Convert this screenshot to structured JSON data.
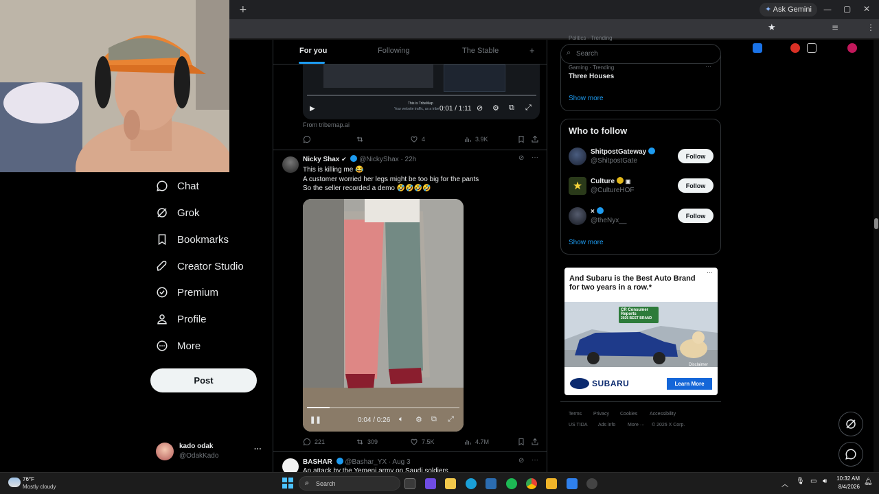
{
  "browser": {
    "ask_gemini": "Ask Gemini",
    "new_tab": "+",
    "minimize": "—",
    "maximize": "▢",
    "close": "✕"
  },
  "nav": {
    "items": [
      {
        "label": "Chat",
        "icon": "chat-icon"
      },
      {
        "label": "Grok",
        "icon": "grok-icon"
      },
      {
        "label": "Bookmarks",
        "icon": "bookmark-icon"
      },
      {
        "label": "Creator Studio",
        "icon": "rocket-icon"
      },
      {
        "label": "Premium",
        "icon": "premium-icon"
      },
      {
        "label": "Profile",
        "icon": "profile-icon"
      },
      {
        "label": "More",
        "icon": "more-icon"
      }
    ],
    "post_label": "Post",
    "account": {
      "name": "kado odak",
      "handle": "@OdakKado",
      "menu": "···"
    }
  },
  "feed": {
    "tabs": [
      "For you",
      "Following",
      "The Stable"
    ],
    "add_tab": "+",
    "tweet0": {
      "video_time": "0:01 / 1:11",
      "video_caption": "This is TribeMap",
      "video_caption_sub": "Your website traffic, as a tribe",
      "from": "From tribemap.ai",
      "likes": "4",
      "views": "3.9K"
    },
    "tweet1": {
      "name": "Nicky Shax",
      "handle": "@NickyShax",
      "time": "· 22h",
      "lines": [
        "This is killing me 😂",
        "A customer worried her legs might be too big for the pants",
        "So the seller recorded a demo 🤣🤣🤣🤣"
      ],
      "video_time": "0:04 / 0:26",
      "video_progress": 0.15,
      "replies": "221",
      "reposts": "309",
      "likes": "7.5K",
      "views": "4.7M",
      "menu": "···"
    },
    "tweet2": {
      "name": "BASHAR",
      "handle": "@Bashar_YX",
      "time": "· Aug 3",
      "line": "An attack by the Yemeni army on Saudi soldiers"
    }
  },
  "sidebar": {
    "search_placeholder": "Search",
    "partial_top": "Politics · Trending",
    "trend": {
      "category": "Gaming · Trending",
      "title": "Three Houses",
      "menu": "···"
    },
    "show_more": "Show more",
    "who_to_follow": {
      "title": "Who to follow",
      "users": [
        {
          "name": "ShitpostGateway",
          "handle": "@ShitpostGate",
          "button": "Follow"
        },
        {
          "name": "Culture",
          "handle": "@CultureHOF",
          "button": "Follow"
        },
        {
          "name": "×",
          "handle": "@theNyx__",
          "button": "Follow"
        }
      ],
      "show_more": "Show more"
    },
    "ad": {
      "headline": "And Subaru is the Best Auto Brand for two years in a row.*",
      "badge_top": "CR Consumer Reports",
      "badge_bottom": "2026 BEST BRAND",
      "disclaimer": "Disclaimer",
      "brand": "SUBARU",
      "cta": "Learn More",
      "menu": "···"
    },
    "footer": {
      "links": [
        "Terms",
        "Privacy",
        "Cookies",
        "Accessibility",
        "US TIDA",
        "Ads info",
        "More ···"
      ],
      "copyright": "© 2026 X Corp."
    }
  },
  "taskbar": {
    "temp": "76°F",
    "weather": "Mostly cloudy",
    "search": "Search",
    "time": "10:32 AM",
    "date": "8/4/2026"
  },
  "colors": {
    "accent": "#1d9bf0",
    "background": "#000000",
    "text": "#e7e9ea",
    "muted": "#71767b",
    "border": "#2f3336"
  }
}
